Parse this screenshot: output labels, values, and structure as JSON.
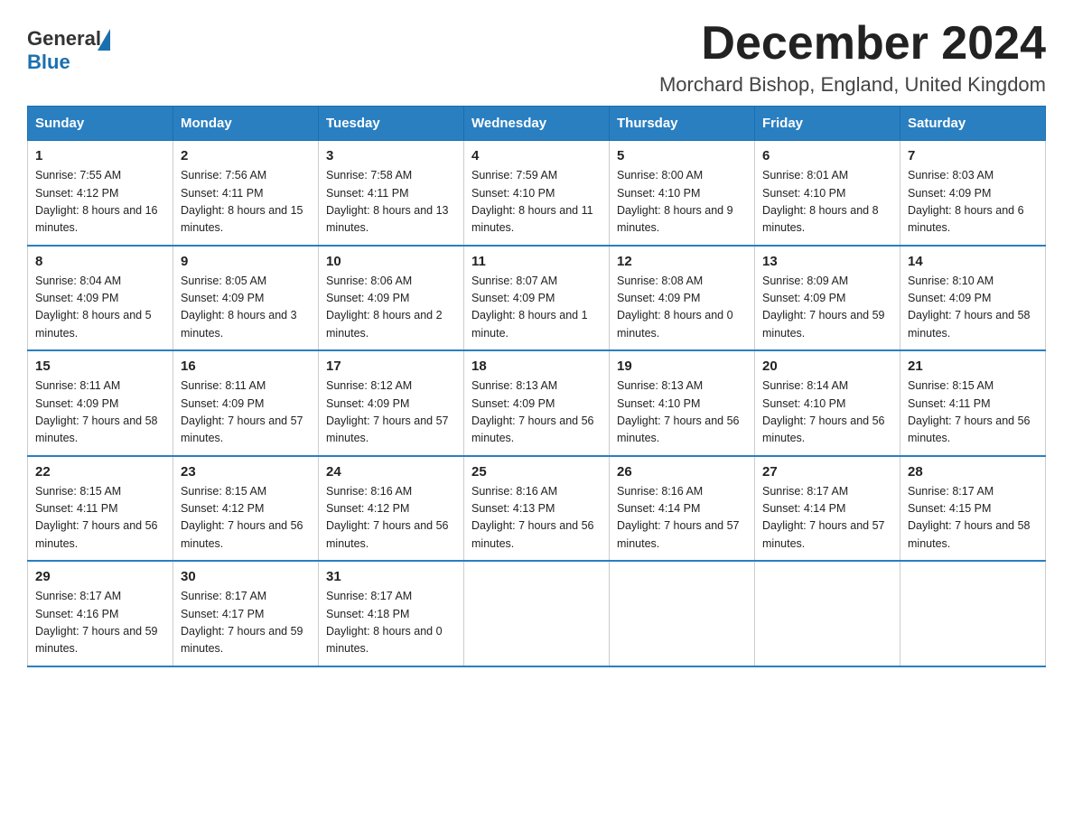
{
  "logo": {
    "text_general": "General",
    "text_blue": "Blue"
  },
  "title": "December 2024",
  "subtitle": "Morchard Bishop, England, United Kingdom",
  "days_of_week": [
    "Sunday",
    "Monday",
    "Tuesday",
    "Wednesday",
    "Thursday",
    "Friday",
    "Saturday"
  ],
  "weeks": [
    [
      {
        "day": "1",
        "sunrise": "7:55 AM",
        "sunset": "4:12 PM",
        "daylight": "8 hours and 16 minutes."
      },
      {
        "day": "2",
        "sunrise": "7:56 AM",
        "sunset": "4:11 PM",
        "daylight": "8 hours and 15 minutes."
      },
      {
        "day": "3",
        "sunrise": "7:58 AM",
        "sunset": "4:11 PM",
        "daylight": "8 hours and 13 minutes."
      },
      {
        "day": "4",
        "sunrise": "7:59 AM",
        "sunset": "4:10 PM",
        "daylight": "8 hours and 11 minutes."
      },
      {
        "day": "5",
        "sunrise": "8:00 AM",
        "sunset": "4:10 PM",
        "daylight": "8 hours and 9 minutes."
      },
      {
        "day": "6",
        "sunrise": "8:01 AM",
        "sunset": "4:10 PM",
        "daylight": "8 hours and 8 minutes."
      },
      {
        "day": "7",
        "sunrise": "8:03 AM",
        "sunset": "4:09 PM",
        "daylight": "8 hours and 6 minutes."
      }
    ],
    [
      {
        "day": "8",
        "sunrise": "8:04 AM",
        "sunset": "4:09 PM",
        "daylight": "8 hours and 5 minutes."
      },
      {
        "day": "9",
        "sunrise": "8:05 AM",
        "sunset": "4:09 PM",
        "daylight": "8 hours and 3 minutes."
      },
      {
        "day": "10",
        "sunrise": "8:06 AM",
        "sunset": "4:09 PM",
        "daylight": "8 hours and 2 minutes."
      },
      {
        "day": "11",
        "sunrise": "8:07 AM",
        "sunset": "4:09 PM",
        "daylight": "8 hours and 1 minute."
      },
      {
        "day": "12",
        "sunrise": "8:08 AM",
        "sunset": "4:09 PM",
        "daylight": "8 hours and 0 minutes."
      },
      {
        "day": "13",
        "sunrise": "8:09 AM",
        "sunset": "4:09 PM",
        "daylight": "7 hours and 59 minutes."
      },
      {
        "day": "14",
        "sunrise": "8:10 AM",
        "sunset": "4:09 PM",
        "daylight": "7 hours and 58 minutes."
      }
    ],
    [
      {
        "day": "15",
        "sunrise": "8:11 AM",
        "sunset": "4:09 PM",
        "daylight": "7 hours and 58 minutes."
      },
      {
        "day": "16",
        "sunrise": "8:11 AM",
        "sunset": "4:09 PM",
        "daylight": "7 hours and 57 minutes."
      },
      {
        "day": "17",
        "sunrise": "8:12 AM",
        "sunset": "4:09 PM",
        "daylight": "7 hours and 57 minutes."
      },
      {
        "day": "18",
        "sunrise": "8:13 AM",
        "sunset": "4:09 PM",
        "daylight": "7 hours and 56 minutes."
      },
      {
        "day": "19",
        "sunrise": "8:13 AM",
        "sunset": "4:10 PM",
        "daylight": "7 hours and 56 minutes."
      },
      {
        "day": "20",
        "sunrise": "8:14 AM",
        "sunset": "4:10 PM",
        "daylight": "7 hours and 56 minutes."
      },
      {
        "day": "21",
        "sunrise": "8:15 AM",
        "sunset": "4:11 PM",
        "daylight": "7 hours and 56 minutes."
      }
    ],
    [
      {
        "day": "22",
        "sunrise": "8:15 AM",
        "sunset": "4:11 PM",
        "daylight": "7 hours and 56 minutes."
      },
      {
        "day": "23",
        "sunrise": "8:15 AM",
        "sunset": "4:12 PM",
        "daylight": "7 hours and 56 minutes."
      },
      {
        "day": "24",
        "sunrise": "8:16 AM",
        "sunset": "4:12 PM",
        "daylight": "7 hours and 56 minutes."
      },
      {
        "day": "25",
        "sunrise": "8:16 AM",
        "sunset": "4:13 PM",
        "daylight": "7 hours and 56 minutes."
      },
      {
        "day": "26",
        "sunrise": "8:16 AM",
        "sunset": "4:14 PM",
        "daylight": "7 hours and 57 minutes."
      },
      {
        "day": "27",
        "sunrise": "8:17 AM",
        "sunset": "4:14 PM",
        "daylight": "7 hours and 57 minutes."
      },
      {
        "day": "28",
        "sunrise": "8:17 AM",
        "sunset": "4:15 PM",
        "daylight": "7 hours and 58 minutes."
      }
    ],
    [
      {
        "day": "29",
        "sunrise": "8:17 AM",
        "sunset": "4:16 PM",
        "daylight": "7 hours and 59 minutes."
      },
      {
        "day": "30",
        "sunrise": "8:17 AM",
        "sunset": "4:17 PM",
        "daylight": "7 hours and 59 minutes."
      },
      {
        "day": "31",
        "sunrise": "8:17 AM",
        "sunset": "4:18 PM",
        "daylight": "8 hours and 0 minutes."
      },
      null,
      null,
      null,
      null
    ]
  ]
}
